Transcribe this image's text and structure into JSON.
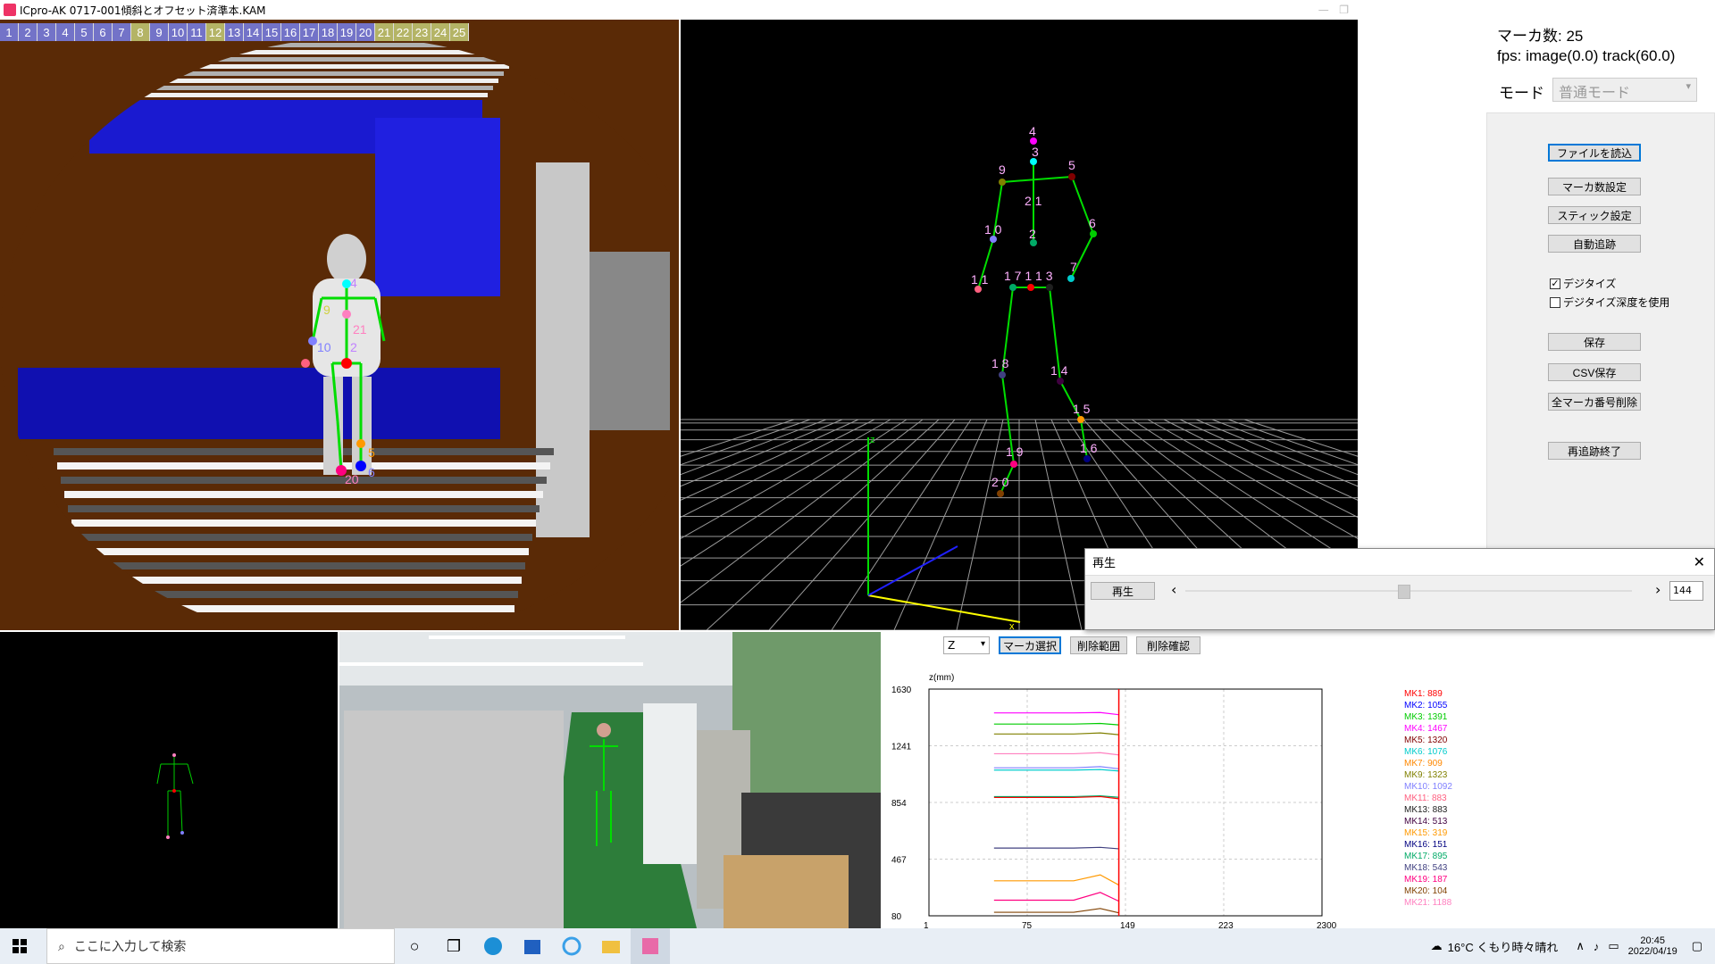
{
  "window": {
    "title": "ICpro-AK   0717-001傾斜とオフセット済準本.KAM"
  },
  "marker_strip": [
    "1",
    "2",
    "3",
    "4",
    "5",
    "6",
    "7",
    "8",
    "9",
    "10",
    "11",
    "12",
    "13",
    "14",
    "15",
    "16",
    "17",
    "18",
    "19",
    "20",
    "21",
    "22",
    "23",
    "24",
    "25"
  ],
  "right_panel": {
    "marker_count": "マーカ数:  25",
    "fps_text": "fps:   image(0.0)   track(60.0)",
    "mode_label": "モード",
    "mode_value": "普通モード",
    "buttons": {
      "load_file": "ファイルを読込",
      "marker_count_setting": "マーカ数設定",
      "stick_setting": "スティック設定",
      "auto_track": "自動追跡",
      "save": "保存",
      "csv_save": "CSV保存",
      "delete_all_marker_numbers": "全マーカ番号削除",
      "retrack_end": "再追跡終了"
    },
    "checkboxes": {
      "digitize": "デジタイズ",
      "use_digitize_depth": "デジタイズ深度を使用"
    }
  },
  "playback_dialog": {
    "title": "再生",
    "play_button": "再生",
    "left_arrow": "‹",
    "right_arrow": "›",
    "frame_value": "144",
    "slider_position": 0.49
  },
  "graph_toolbar": {
    "axis_select": "Z",
    "marker_select": "マーカ選択",
    "delete_range": "削除範囲",
    "delete_confirm": "削除確認"
  },
  "view3d_labels": [
    "4",
    "3",
    "5",
    "9",
    "2 1",
    "1 0",
    "2",
    "6",
    "1 1",
    "1 7 1 1 3",
    "7",
    "1 8",
    "1 4",
    "1 5",
    "1 9",
    "1 6",
    "2 0"
  ],
  "depth_view_labels": [
    "4",
    "9",
    "21",
    "10",
    "2",
    "5",
    "6",
    "20"
  ],
  "chart_data": {
    "type": "line",
    "ylabel": "z(mm)",
    "yticks": [
      "1630",
      "1241",
      "854",
      "467",
      "80"
    ],
    "xticks": [
      "1",
      "75",
      "149",
      "223",
      "2300"
    ],
    "ylim": [
      80,
      1630
    ],
    "xlim": [
      1,
      297
    ],
    "current_frame": 144,
    "legend": [
      {
        "name": "MK1: 889",
        "color": "#ff0000"
      },
      {
        "name": "MK2: 1055",
        "color": "#0000ff"
      },
      {
        "name": "MK3: 1391",
        "color": "#00cc00"
      },
      {
        "name": "MK4: 1467",
        "color": "#ff00ff"
      },
      {
        "name": "MK5: 1320",
        "color": "#800000"
      },
      {
        "name": "MK6: 1076",
        "color": "#00cccc"
      },
      {
        "name": "MK7: 909",
        "color": "#ff8800"
      },
      {
        "name": "MK9: 1323",
        "color": "#808000"
      },
      {
        "name": "MK10: 1092",
        "color": "#8080ff"
      },
      {
        "name": "MK11: 883",
        "color": "#ff6080"
      },
      {
        "name": "MK13: 883",
        "color": "#202020"
      },
      {
        "name": "MK14: 513",
        "color": "#400040"
      },
      {
        "name": "MK15: 319",
        "color": "#ff9900"
      },
      {
        "name": "MK16: 151",
        "color": "#000080"
      },
      {
        "name": "MK17: 895",
        "color": "#00aa66"
      },
      {
        "name": "MK18: 543",
        "color": "#404080"
      },
      {
        "name": "MK19: 187",
        "color": "#ff0080"
      },
      {
        "name": "MK20: 104",
        "color": "#804000"
      },
      {
        "name": "MK21: 1188",
        "color": "#ff80c0"
      }
    ],
    "series": [
      {
        "name": "MK4: 1467",
        "color": "#ff00ff",
        "values": [
          1467,
          1467,
          1467,
          1470,
          1455
        ]
      },
      {
        "name": "MK3: 1391",
        "color": "#00cc00",
        "values": [
          1391,
          1391,
          1391,
          1395,
          1385
        ]
      },
      {
        "name": "MK9: 1323",
        "color": "#808000",
        "values": [
          1323,
          1323,
          1323,
          1330,
          1318
        ]
      },
      {
        "name": "MK21: 1188",
        "color": "#ff80c0",
        "values": [
          1188,
          1188,
          1188,
          1195,
          1180
        ]
      },
      {
        "name": "MK10: 1092",
        "color": "#8080ff",
        "values": [
          1092,
          1092,
          1092,
          1100,
          1085
        ]
      },
      {
        "name": "MK6: 1076",
        "color": "#00cccc",
        "values": [
          1076,
          1076,
          1076,
          1080,
          1070
        ]
      },
      {
        "name": "MK17: 895",
        "color": "#00aa66",
        "values": [
          895,
          895,
          895,
          900,
          890
        ]
      },
      {
        "name": "MK1: 889",
        "color": "#ff0000",
        "values": [
          889,
          889,
          889,
          895,
          880
        ]
      },
      {
        "name": "MK18: 543",
        "color": "#404080",
        "values": [
          543,
          543,
          543,
          548,
          538
        ]
      },
      {
        "name": "MK15: 319",
        "color": "#ff9900",
        "values": [
          319,
          319,
          319,
          360,
          290
        ]
      },
      {
        "name": "MK19: 187",
        "color": "#ff0080",
        "values": [
          187,
          187,
          187,
          240,
          180
        ]
      },
      {
        "name": "MK20: 104",
        "color": "#804000",
        "values": [
          104,
          104,
          104,
          130,
          100
        ]
      }
    ],
    "series_x": [
      50,
      60,
      110,
      130,
      144
    ]
  },
  "taskbar": {
    "search_placeholder": "ここに入力して検索",
    "weather": "16°C  くもり時々晴れ",
    "time": "20:45",
    "date": "2022/04/19"
  }
}
